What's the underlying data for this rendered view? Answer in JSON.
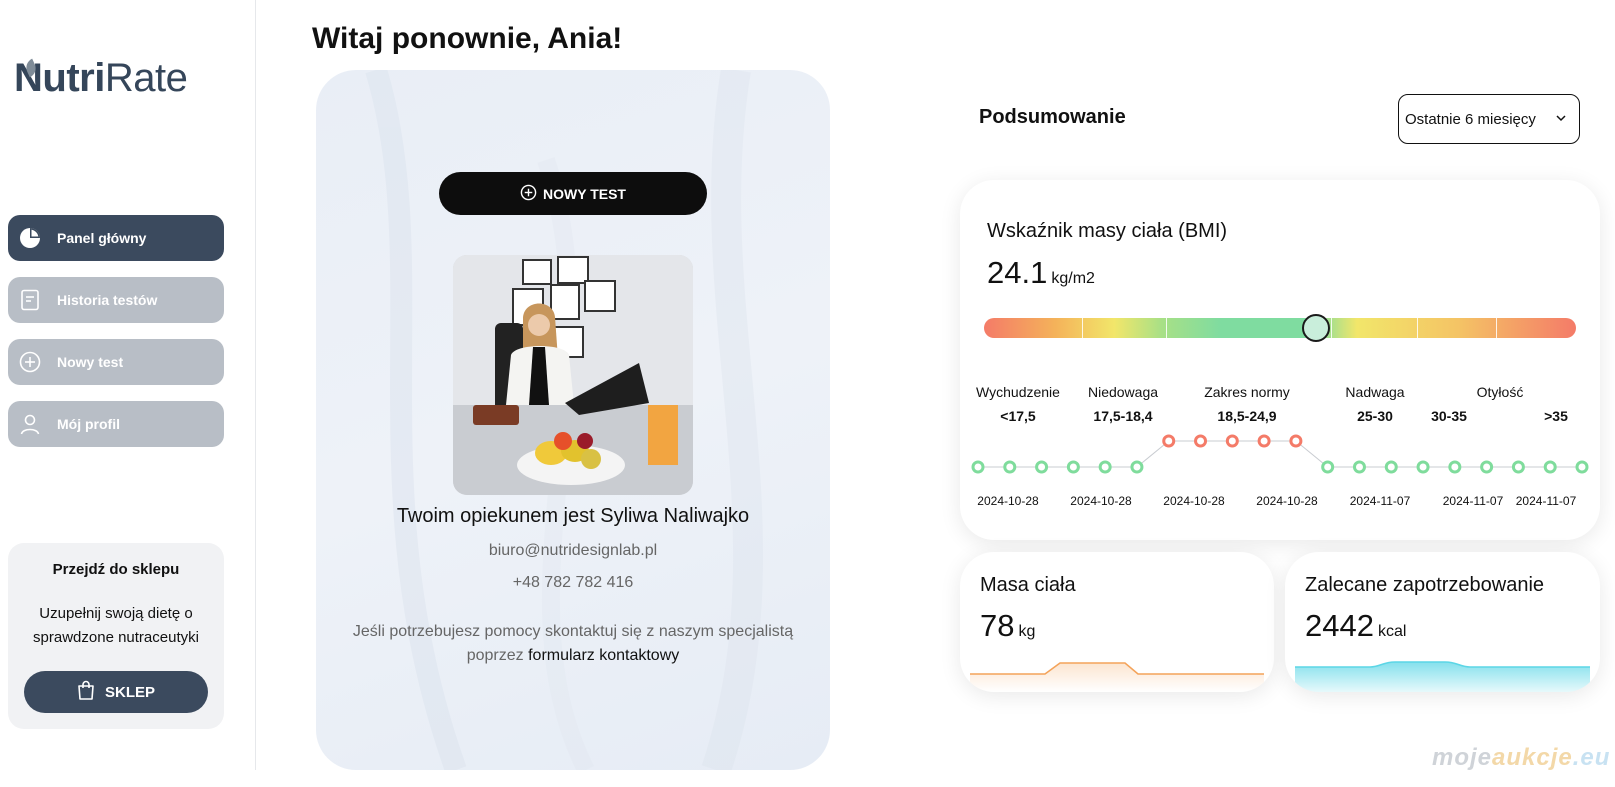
{
  "brand": {
    "name_bold": "Nutri",
    "name_light": "Rate"
  },
  "sidebar": {
    "items": [
      {
        "label": "Panel główny",
        "icon": "pie-chart-icon",
        "active": true
      },
      {
        "label": "Historia testów",
        "icon": "document-icon",
        "active": false
      },
      {
        "label": "Nowy test",
        "icon": "plus-circle-icon",
        "active": false
      },
      {
        "label": "Mój profil",
        "icon": "user-icon",
        "active": false
      }
    ],
    "shop": {
      "title": "Przejdź do sklepu",
      "text": "Uzupełnij swoją dietę o sprawdzone nutraceutyki",
      "button": "SKLEP"
    }
  },
  "header": {
    "welcome": "Witaj ponownie, Ania!"
  },
  "caretaker_card": {
    "new_test_button": "NOWY TEST",
    "caretaker_line": "Twoim opiekunem jest Syliwa Naliwajko",
    "email": "biuro@nutridesignlab.pl",
    "phone": "+48 782 782 416",
    "help_text": "Jeśli potrzebujesz pomocy skontaktuj się z naszym specjalistą poprzez",
    "help_link": "formularz kontaktowy"
  },
  "summary": {
    "title": "Podsumowanie",
    "period": "Ostatnie 6 miesięcy"
  },
  "bmi": {
    "title": "Wskaźnik masy ciała (BMI)",
    "value": "24.1",
    "unit": "kg/m2",
    "marker_fraction": 0.56,
    "ranges": [
      {
        "label": "Wychudzenie",
        "value": "<17,5"
      },
      {
        "label": "Niedowaga",
        "value": "17,5-18,4"
      },
      {
        "label": "Zakres normy",
        "value": "18,5-24,9"
      },
      {
        "label": "Nadwaga",
        "value": "25-30"
      },
      {
        "label": "Otyłość",
        "value": "30-35"
      },
      {
        "label": "",
        "value": ">35"
      }
    ],
    "history_dates": [
      "2024-10-28",
      "2024-10-28",
      "2024-10-28",
      "2024-10-28",
      "2024-11-07",
      "2024-11-07",
      "2024-11-07"
    ],
    "history_status": [
      "normal",
      "normal",
      "normal",
      "normal",
      "normal",
      "normal",
      "high",
      "high",
      "high",
      "high",
      "high",
      "normal",
      "normal",
      "normal",
      "normal",
      "normal",
      "normal",
      "normal",
      "normal",
      "normal"
    ],
    "colors": {
      "normal": "#7fdc9c",
      "high": "#f47b68"
    }
  },
  "mass": {
    "title": "Masa ciała",
    "value": "78",
    "unit": "kg",
    "color": "#f4a35a"
  },
  "energy": {
    "title": "Zalecane zapotrzebowanie",
    "value": "2442",
    "unit": "kcal",
    "color": "#5cd6e6"
  },
  "watermark": {
    "part1": "moje",
    "part2": "aukcje",
    "part3": ".eu"
  }
}
